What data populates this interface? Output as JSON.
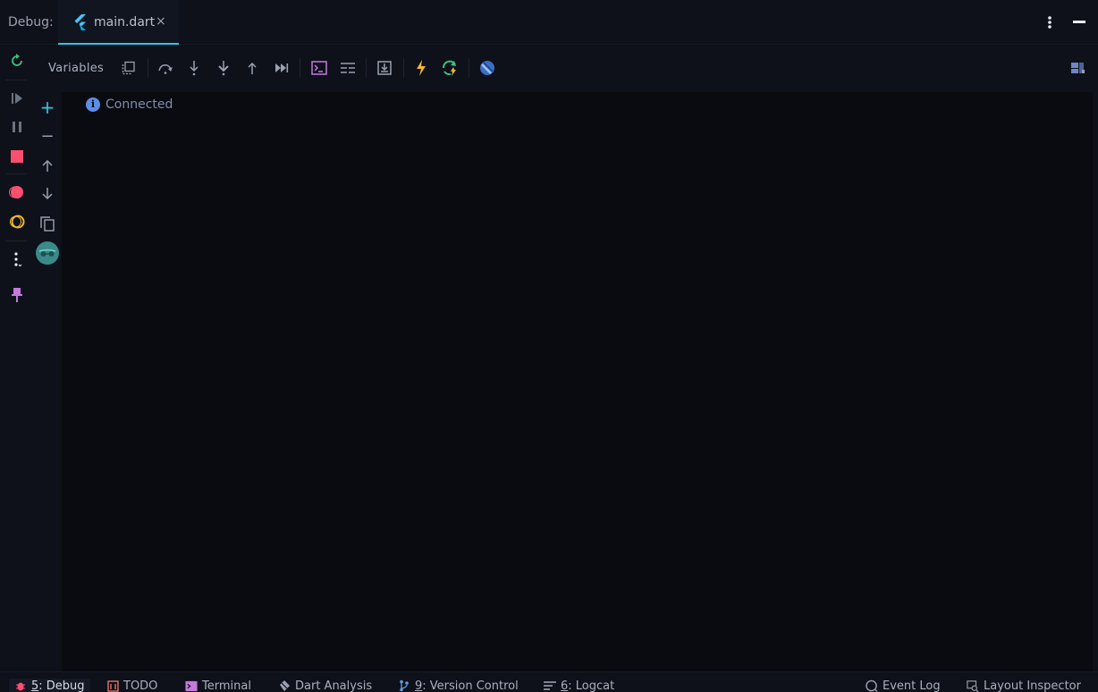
{
  "header": {
    "debug_label": "Debug:",
    "tab_label": "main.dart",
    "close_glyph": "×"
  },
  "left_strip": {
    "icons": [
      "rerun-icon",
      "resume-icon",
      "pause-icon",
      "stop-icon",
      "view-breakpoints-icon",
      "mute-breakpoints-icon",
      "more-icon",
      "pin-icon"
    ]
  },
  "second_strip": {
    "add_glyph": "+",
    "remove_glyph": "−",
    "icons": [
      "add-icon",
      "remove-icon",
      "move-up-icon",
      "move-down-icon",
      "copy-icon",
      "incognito-avatar-icon"
    ]
  },
  "toolbar": {
    "variables_label": "Variables",
    "icons": [
      "restore-layout-icon",
      "step-over-icon",
      "step-into-icon",
      "force-step-into-icon",
      "step-out-icon",
      "run-to-cursor-icon",
      "console-icon",
      "evaluate-icon",
      "get-thread-dump-icon",
      "hot-reload-icon",
      "hot-restart-icon",
      "dart-devtools-icon",
      "layout-settings-icon"
    ]
  },
  "console": {
    "status_text": "Connected"
  },
  "bottom_bar": {
    "items": [
      {
        "num": "5",
        "label": ": Debug"
      },
      {
        "num": "",
        "label": "TODO"
      },
      {
        "num": "",
        "label": "Terminal"
      },
      {
        "num": "",
        "label": "Dart Analysis"
      },
      {
        "num": "9",
        "label": ": Version Control"
      },
      {
        "num": "6",
        "label": ": Logcat"
      },
      {
        "num": "",
        "label": "Event Log"
      },
      {
        "num": "",
        "label": "Layout Inspector"
      }
    ]
  },
  "colors": {
    "accent": "#33c5e6",
    "stop": "#ff4f6e",
    "lightning": "#f2b632",
    "rerun": "#3fbf7f",
    "console_purple": "#c678dd",
    "pin": "#c678dd"
  }
}
